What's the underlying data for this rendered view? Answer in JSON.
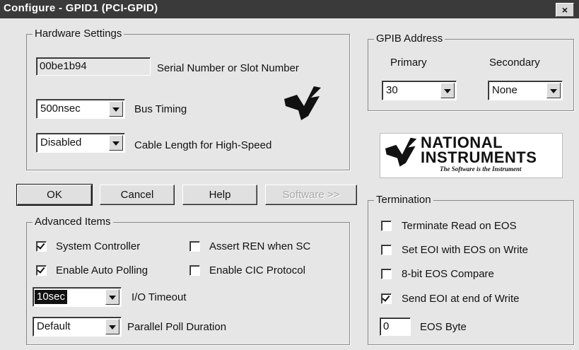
{
  "window": {
    "title": "Configure - GPID1 (PCI-GPID)",
    "close_label": "×"
  },
  "hardware": {
    "group_label": "Hardware Settings",
    "serial_value": "00be1b94",
    "serial_label": "Serial Number or Slot Number",
    "bus_timing_value": "500nsec",
    "bus_timing_label": "Bus Timing",
    "cable_length_value": "Disabled",
    "cable_length_label": "Cable Length for High-Speed"
  },
  "gpib_address": {
    "group_label": "GPIB Address",
    "primary_label": "Primary",
    "primary_value": "30",
    "secondary_label": "Secondary",
    "secondary_value": "None"
  },
  "logo": {
    "line1": "NATIONAL",
    "line2": "INSTRUMENTS",
    "slogan": "The Software is the Instrument"
  },
  "buttons": {
    "ok": "OK",
    "cancel": "Cancel",
    "help": "Help",
    "software": "Software >>"
  },
  "advanced": {
    "group_label": "Advanced Items",
    "system_controller": {
      "label": "System Controller",
      "checked": true
    },
    "assert_ren": {
      "label": "Assert REN when SC",
      "checked": false
    },
    "auto_polling": {
      "label": "Enable Auto Polling",
      "checked": true
    },
    "cic_protocol": {
      "label": "Enable CIC Protocol",
      "checked": false
    },
    "io_timeout_value": "10sec",
    "io_timeout_label": "I/O Timeout",
    "parallel_poll_value": "Default",
    "parallel_poll_label": "Parallel Poll Duration"
  },
  "termination": {
    "group_label": "Termination",
    "terminate_read_eos": {
      "label": "Terminate Read on EOS",
      "checked": false
    },
    "set_eoi_eos": {
      "label": "Set EOI with EOS on Write",
      "checked": false
    },
    "eos_compare_8bit": {
      "label": "8-bit EOS Compare",
      "checked": false
    },
    "send_eoi_end": {
      "label": "Send EOI at end of Write",
      "checked": true
    },
    "eos_byte_value": "0",
    "eos_byte_label": "EOS Byte"
  }
}
